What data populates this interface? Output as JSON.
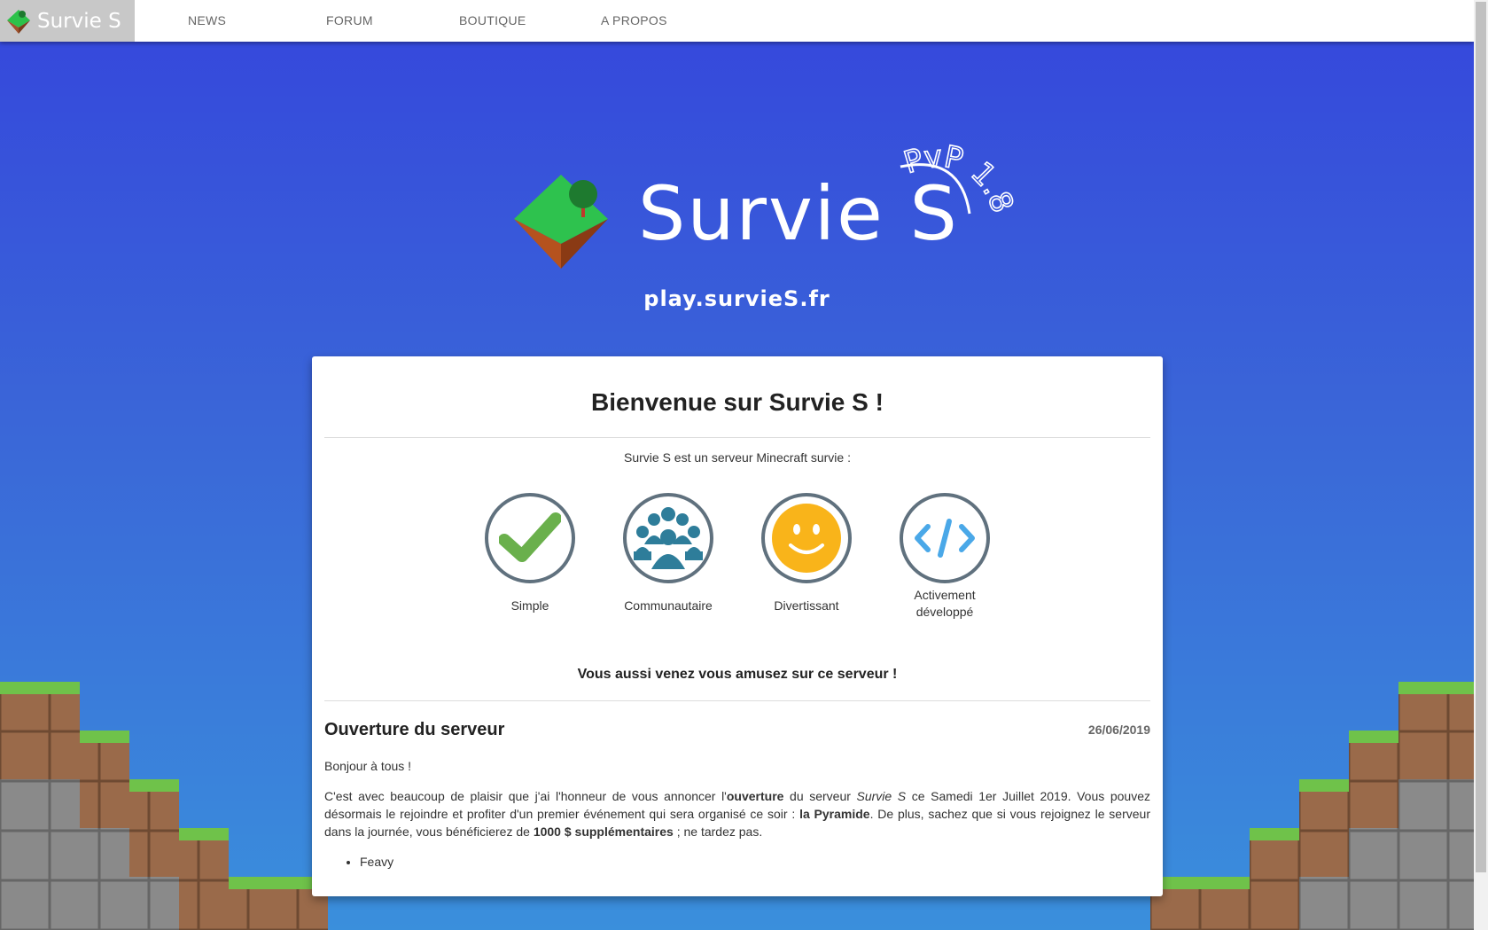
{
  "navbar": {
    "brand": "Survie S",
    "items": [
      "NEWS",
      "FORUM",
      "BOUTIQUE",
      "A PROPOS"
    ]
  },
  "hero": {
    "title": "Survie S",
    "version": "PvP 1.8",
    "server_ip": "play.survieS.fr"
  },
  "card": {
    "title": "Bienvenue sur Survie S !",
    "intro": "Survie S est un serveur Minecraft survie :",
    "features": [
      {
        "label": "Simple",
        "icon": "checkmark-icon"
      },
      {
        "label": "Communautaire",
        "icon": "community-icon"
      },
      {
        "label": "Divertissant",
        "icon": "smiley-icon"
      },
      {
        "label": "Activement développé",
        "icon": "code-icon"
      }
    ],
    "cta": "Vous aussi venez vous amusez sur ce serveur !"
  },
  "post": {
    "title": "Ouverture du serveur",
    "date": "26/06/2019",
    "greeting": "Bonjour à tous !",
    "body_parts": {
      "p1": "C'est avec beaucoup de plaisir que j'ai l'honneur de vous annoncer l'",
      "b1": "ouverture",
      "p2": " du serveur ",
      "i1": "Survie S",
      "p3": " ce Samedi 1er Juillet 2019. Vous pouvez désormais le rejoindre et profiter d'un premier événement qui sera organisé ce soir : ",
      "b2": "la Pyramide",
      "p4": ". De plus, sachez que si vous rejoignez le serveur dans la journée, vous bénéficierez de ",
      "b3": "1000 $ supplémentaires",
      "p5": " ; ne tardez pas."
    },
    "author": "Feavy"
  },
  "colors": {
    "accent_green": "#6ab04c",
    "accent_teal": "#2e7d9a",
    "accent_yellow": "#f9b41a",
    "accent_blue": "#4aa8e8",
    "icon_border": "#60717e"
  }
}
